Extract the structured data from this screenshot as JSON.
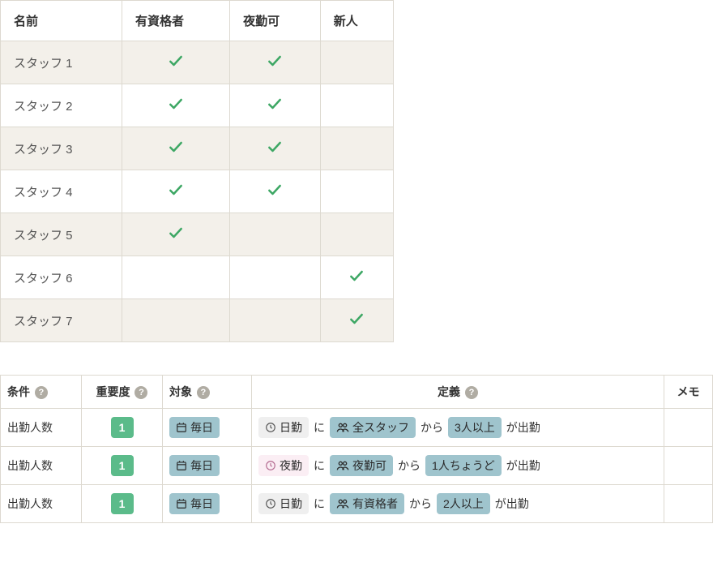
{
  "staffTable": {
    "headers": [
      "名前",
      "有資格者",
      "夜勤可",
      "新人"
    ],
    "rows": [
      {
        "name": "スタッフ 1",
        "qualified": true,
        "nightOk": true,
        "newcomer": false
      },
      {
        "name": "スタッフ 2",
        "qualified": true,
        "nightOk": true,
        "newcomer": false
      },
      {
        "name": "スタッフ 3",
        "qualified": true,
        "nightOk": true,
        "newcomer": false
      },
      {
        "name": "スタッフ 4",
        "qualified": true,
        "nightOk": true,
        "newcomer": false
      },
      {
        "name": "スタッフ 5",
        "qualified": true,
        "nightOk": false,
        "newcomer": false
      },
      {
        "name": "スタッフ 6",
        "qualified": false,
        "nightOk": false,
        "newcomer": true
      },
      {
        "name": "スタッフ 7",
        "qualified": false,
        "nightOk": false,
        "newcomer": true
      }
    ]
  },
  "conditionsTable": {
    "headers": {
      "condition": "条件",
      "importance": "重要度",
      "target": "対象",
      "definition": "定義",
      "memo": "メモ"
    },
    "rows": [
      {
        "condition": "出勤人数",
        "importance": "1",
        "target": "毎日",
        "shift": "日勤",
        "shiftStyle": "light",
        "joiner1": "に",
        "group": "全スタッフ",
        "joiner2": "から",
        "count": "3人以上",
        "suffix": "が出勤",
        "memo": ""
      },
      {
        "condition": "出勤人数",
        "importance": "1",
        "target": "毎日",
        "shift": "夜勤",
        "shiftStyle": "pink",
        "joiner1": "に",
        "group": "夜勤可",
        "joiner2": "から",
        "count": "1人ちょうど",
        "suffix": "が出勤",
        "memo": ""
      },
      {
        "condition": "出勤人数",
        "importance": "1",
        "target": "毎日",
        "shift": "日勤",
        "shiftStyle": "light",
        "joiner1": "に",
        "group": "有資格者",
        "joiner2": "から",
        "count": "2人以上",
        "suffix": "が出勤",
        "memo": ""
      }
    ]
  },
  "helpGlyph": "?"
}
